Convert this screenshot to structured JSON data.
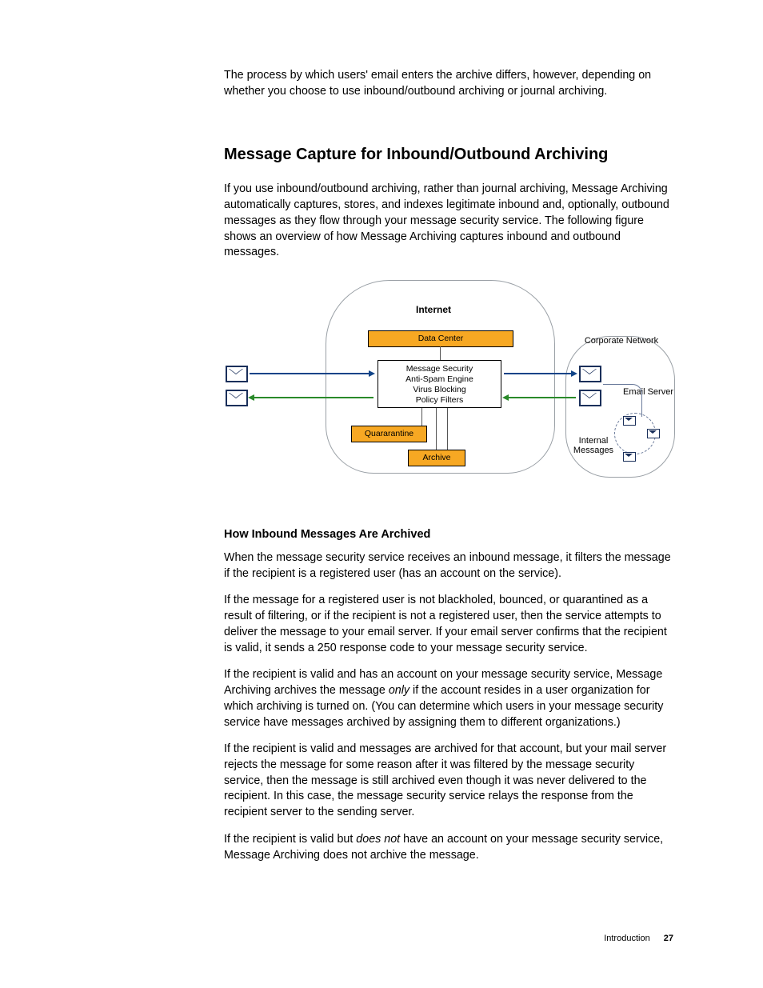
{
  "intro_para": "The process by which users' email enters the archive differs, however, depending on whether you choose to use inbound/outbound archiving or journal archiving.",
  "heading": "Message Capture for Inbound/Outbound Archiving",
  "heading_para": "If you use inbound/outbound archiving, rather than journal archiving, Message Archiving automatically captures, stores, and indexes legitimate inbound and, optionally, outbound messages as they flow through your message security service. The following figure shows an overview of how Message Archiving captures inbound and outbound messages.",
  "diagram": {
    "internet": "Internet",
    "data_center": "Data Center",
    "ms_l1": "Message Security",
    "ms_l2": "Anti-Spam Engine",
    "ms_l3": "Virus Blocking",
    "ms_l4": "Policy Filters",
    "quarantine": "Quararantine",
    "archive": "Archive",
    "corp_net": "Corporate Network",
    "email_server": "Email Server",
    "internal_msgs_l1": "Internal",
    "internal_msgs_l2": "Messages"
  },
  "sub_heading": "How Inbound Messages Are Archived",
  "p1": "When the message security service receives an inbound message, it filters the message if the recipient is a registered user (has an account on the service).",
  "p2": "If the message for a registered user is not blackholed, bounced, or quarantined as a result of filtering, or if the recipient is not a registered user, then the service attempts to deliver the message to your email server. If your email server confirms that the recipient is valid, it sends a 250 response code to your message security service.",
  "p3a": "If the recipient is valid and has an account on your message security service, Message Archiving archives the message ",
  "p3_em": "only",
  "p3b": " if the account resides in a user organization for which archiving is turned on. (You can determine which users in your message security service have messages archived by assigning them to different organizations.)",
  "p4": "If the recipient is valid and messages are archived for that account, but your mail server rejects the message for some reason after it was filtered by the message security service, then the message is still archived even though it was never delivered to the recipient. In this case, the message security service relays the response from the recipient server to the sending server.",
  "p5a": "If the recipient is valid but ",
  "p5_em": "does not",
  "p5b": " have an account on your message security service, Message Archiving does not archive the message.",
  "footer_section": "Introduction",
  "footer_page": "27"
}
